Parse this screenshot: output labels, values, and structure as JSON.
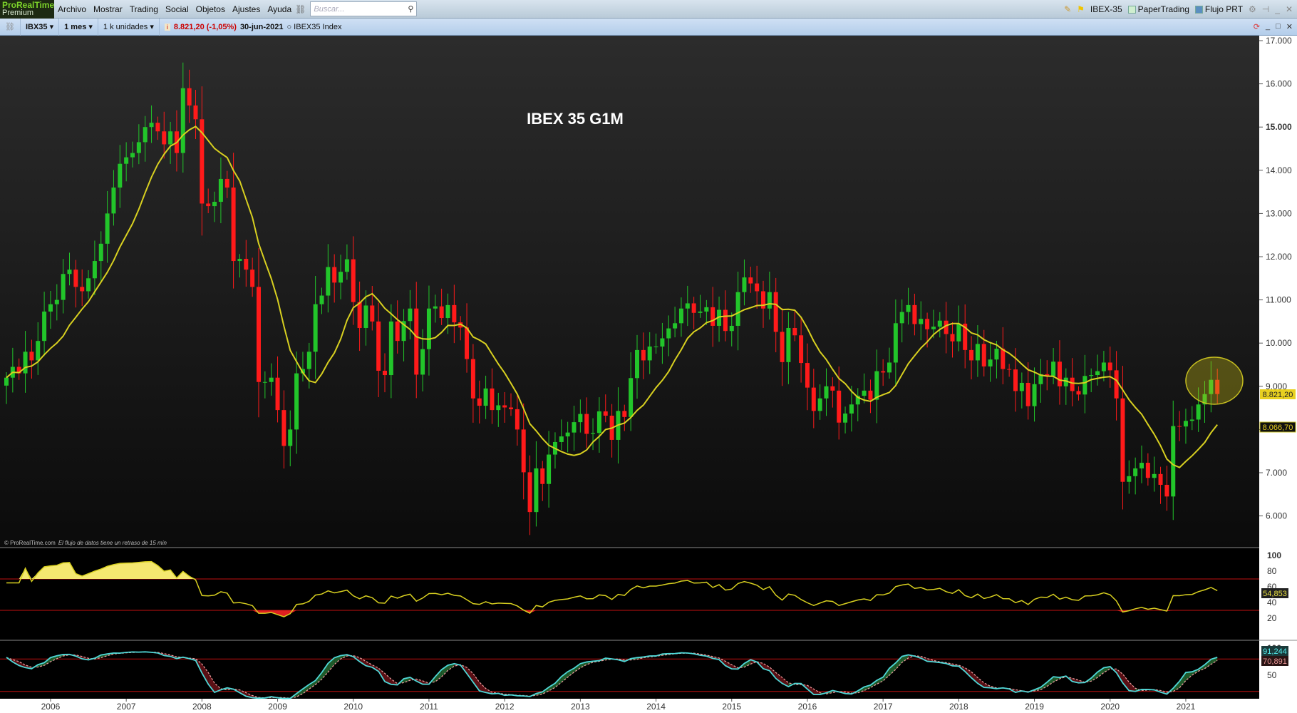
{
  "menubar": {
    "logo": "ProRealTime",
    "logo_sub": "Premium",
    "items": [
      "Archivo",
      "Mostrar",
      "Trading",
      "Social",
      "Objetos",
      "Ajustes",
      "Ayuda"
    ],
    "search_placeholder": "Buscar...",
    "right": {
      "instrument": "IBEX-35",
      "paper": "PaperTrading",
      "flow": "Flujo PRT"
    }
  },
  "toolbar": {
    "ticker": "IBX35",
    "period": "1 mes",
    "units": "1 k unidades",
    "price": "8.821,20 (-1,05%)",
    "date": "30-jun-2021",
    "index": "IBEX35 Index"
  },
  "chart": {
    "title": "IBEX 35 G1M",
    "watermark": "© ProRealTime.com",
    "delay": "El flujo de datos tiene un retraso de 15 min",
    "price_label": "8.821,20",
    "ma_label": "8.066,70",
    "rsi_label": "54,853",
    "stoch_k_label": "91,244",
    "stoch_d_label": "70,891",
    "price_ticks": [
      "17.000",
      "16.000",
      "15.000",
      "14.000",
      "13.000",
      "12.000",
      "11.000",
      "10.000",
      "9.000",
      "8.000",
      "7.000",
      "6.000"
    ],
    "rsi_ticks": [
      "100",
      "80",
      "60",
      "40",
      "20"
    ],
    "stoch_ticks": [
      "100",
      "50"
    ],
    "years": [
      "2006",
      "2007",
      "2008",
      "2009",
      "2010",
      "2011",
      "2012",
      "2013",
      "2014",
      "2015",
      "2016",
      "2017",
      "2018",
      "2019",
      "2020",
      "2021"
    ],
    "colors": {
      "up": "#22c52a",
      "down": "#ff1a1a",
      "ma": "#d8d020",
      "stoch_k": "#4fd8d8",
      "stoch_d": "#f0a0a0"
    }
  },
  "chart_data": {
    "type": "candlestick",
    "start": "2005-06",
    "interval": "1 month",
    "ma_period": 10,
    "closes": [
      9200,
      9450,
      9300,
      9800,
      9600,
      10050,
      10730,
      10900,
      11000,
      11600,
      11700,
      11300,
      11200,
      11500,
      11900,
      12300,
      13000,
      13600,
      14150,
      14300,
      14400,
      14650,
      15000,
      15100,
      14900,
      14600,
      14900,
      14400,
      15900,
      15500,
      15180,
      13230,
      13170,
      13270,
      13800,
      13600,
      11900,
      11950,
      11700,
      11300,
      9100,
      9100,
      9200,
      8450,
      7620,
      8000,
      9300,
      9400,
      9800,
      10900,
      11100,
      11760,
      11400,
      11650,
      11940,
      10950,
      10350,
      10870,
      10500,
      9360,
      9260,
      10500,
      10050,
      10510,
      10800,
      9270,
      9860,
      10800,
      10850,
      10580,
      10880,
      10480,
      10360,
      9630,
      8720,
      8550,
      8950,
      8450,
      8560,
      8510,
      8470,
      8000,
      7010,
      6090,
      7100,
      6740,
      7420,
      7710,
      7840,
      7930,
      8170,
      8360,
      7900,
      7920,
      8420,
      8320,
      7760,
      8430,
      8290,
      9190,
      9840,
      9600,
      9920,
      9920,
      10110,
      10340,
      10460,
      10800,
      10920,
      10700,
      10730,
      10830,
      10400,
      10770,
      10280,
      10400,
      11180,
      11520,
      11380,
      11200,
      10800,
      11180,
      10260,
      9560,
      10350,
      10180,
      9540,
      8970,
      8430,
      8720,
      9000,
      8900,
      8160,
      8370,
      8580,
      8780,
      8900,
      8690,
      9350,
      9320,
      9550,
      10460,
      10720,
      10880,
      10440,
      10560,
      10320,
      10380,
      10520,
      10210,
      10040,
      10450,
      9840,
      9600,
      9980,
      9460,
      9620,
      9870,
      9400,
      9390,
      8890,
      9080,
      8540,
      9050,
      9280,
      9240,
      9570,
      9000,
      9200,
      8890,
      8810,
      9240,
      9260,
      9350,
      9550,
      9370,
      8720,
      6790,
      6920,
      7100,
      7230,
      6880,
      6970,
      6720,
      6450,
      8080,
      8070,
      8200,
      8230,
      8580,
      8820,
      9150,
      8821
    ],
    "ylim": [
      5700,
      17000
    ]
  }
}
